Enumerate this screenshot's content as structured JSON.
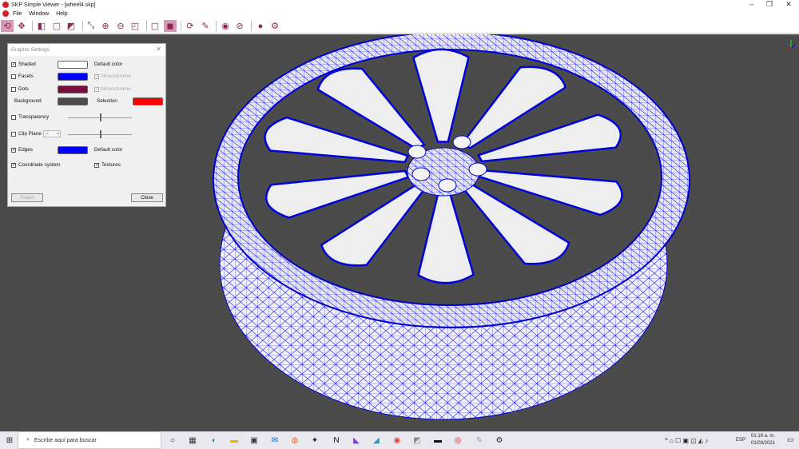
{
  "window": {
    "title": "SKP Simple Viewer - [wheel4.skp]",
    "minimize": "–",
    "restore": "❐",
    "close": "✕"
  },
  "menu": [
    "File",
    "Window",
    "Help"
  ],
  "toolbar": [
    {
      "name": "orbit",
      "glyph": "⟲",
      "active": true
    },
    {
      "name": "pan",
      "glyph": "✥"
    },
    {
      "name": "view-iso",
      "glyph": "◧"
    },
    {
      "name": "view-front",
      "glyph": "▢"
    },
    {
      "name": "view-side",
      "glyph": "◩"
    },
    {
      "name": "zoom-extents",
      "glyph": "⤡"
    },
    {
      "name": "zoom-in",
      "glyph": "⊕"
    },
    {
      "name": "zoom-out",
      "glyph": "⊖"
    },
    {
      "name": "zoom-window",
      "glyph": "◰"
    },
    {
      "name": "wireframe",
      "glyph": "▢"
    },
    {
      "name": "shaded",
      "glyph": "◼",
      "active": true
    },
    {
      "name": "rotate",
      "glyph": "⟳"
    },
    {
      "name": "measure",
      "glyph": "✎"
    },
    {
      "name": "show",
      "glyph": "◉"
    },
    {
      "name": "hide",
      "glyph": "⊘"
    },
    {
      "name": "info",
      "glyph": "●"
    },
    {
      "name": "settings",
      "glyph": "⚙"
    }
  ],
  "dialog": {
    "title": "Graphic Settings",
    "close": "✕",
    "shaded": {
      "label": "Shaded",
      "checked": true,
      "color": "#ffffff",
      "note": "Default color"
    },
    "facets": {
      "label": "Facets",
      "checked": false,
      "color": "#0000ff",
      "note": "Monochrome"
    },
    "dots": {
      "label": "Dots",
      "checked": false,
      "color": "#7a0a3a",
      "note": "Monochrome"
    },
    "background": {
      "label": "Background",
      "color": "#4b4b4b"
    },
    "selection": {
      "label": "Selection",
      "color": "#ff0000"
    },
    "transparency": {
      "label": "Transparency",
      "checked": false,
      "value": 0.5
    },
    "clip_plane": {
      "label": "Clip Plane",
      "checked": false,
      "axis": "X",
      "value": 0.5
    },
    "edges": {
      "label": "Edges",
      "checked": true,
      "color": "#0000ff",
      "note": "Default color"
    },
    "coordinate_system": {
      "label": "Coordinate system",
      "checked": true
    },
    "textures": {
      "label": "Textures",
      "checked": true
    },
    "regen": "Regen",
    "close_button": "Close"
  },
  "taskbar": {
    "search_placeholder": "Escribe aquí para buscar",
    "lang": "ESP",
    "time": "01:19 a. m.",
    "date": "01/03/2021"
  }
}
